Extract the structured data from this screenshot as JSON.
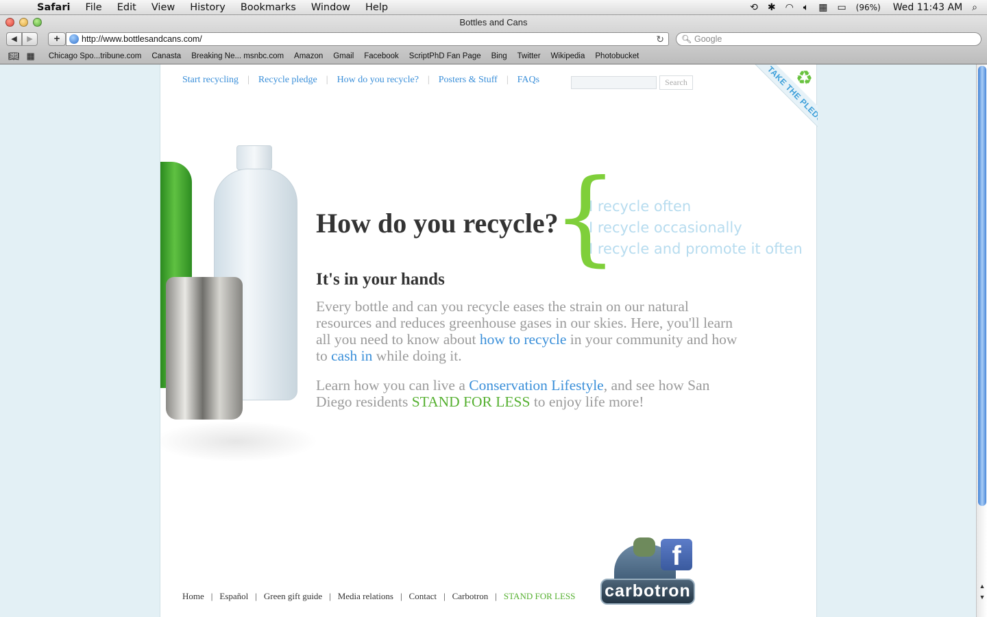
{
  "menubar": {
    "apple_icon": "apple-logo",
    "items": [
      "Safari",
      "File",
      "Edit",
      "View",
      "History",
      "Bookmarks",
      "Window",
      "Help"
    ],
    "status": {
      "battery": "(96%)",
      "clock": "Wed 11:43 AM"
    }
  },
  "browser": {
    "window_title": "Bottles and Cans",
    "url": "http://www.bottlesandcans.com/",
    "search_placeholder": "Google",
    "bookmarks": [
      "Chicago Spo...tribune.com",
      "Canasta",
      "Breaking Ne... msnbc.com",
      "Amazon",
      "Gmail",
      "Facebook",
      "ScriptPhD Fan Page",
      "Bing",
      "Twitter",
      "Wikipedia",
      "Photobucket"
    ]
  },
  "page": {
    "nav": [
      "Start recycling",
      "Recycle pledge",
      "How do you recycle?",
      "Posters & Stuff",
      "FAQs"
    ],
    "search_button": "Search",
    "pledge_ribbon": "TAKE THE PLEDGE",
    "headline": "How do you recycle?",
    "options": [
      "I recycle often",
      "I recycle occasionally",
      "I recycle and promote it often"
    ],
    "subhead": "It's in your hands",
    "para1": {
      "t1": "Every bottle and can you recycle eases the strain on our natural resources and reduces greenhouse gases in our skies. Here, you'll learn all you need to know about ",
      "link1": "how to recycle",
      "t2": " in your community and how to ",
      "link2": "cash in",
      "t3": " while doing it."
    },
    "para2": {
      "t1": "Learn how you can live a ",
      "link1": "Conservation Lifestyle",
      "t2": ", and see how San Diego residents ",
      "link2": "STAND FOR LESS",
      "t3": " to enjoy life more!"
    },
    "footer": [
      "Home",
      "Español",
      "Green gift guide",
      "Media relations",
      "Contact",
      "Carbotron",
      "STAND FOR LESS"
    ],
    "carbotron_logo": "carbotron",
    "facebook_letter": "f",
    "colors": {
      "link": "#3a8fd9",
      "green": "#55b030",
      "option": "#b7dcef",
      "brace": "#7fcf3a",
      "background": "#e3f0f5"
    }
  }
}
